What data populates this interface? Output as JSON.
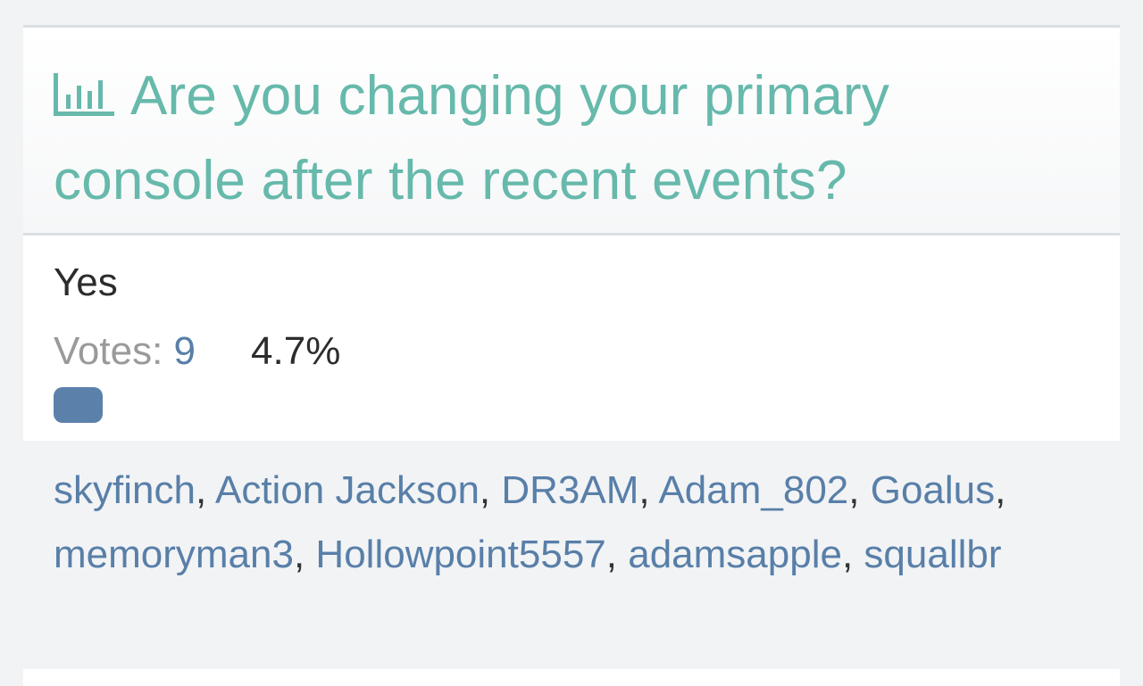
{
  "poll": {
    "title": "Are you changing your primary console after the recent events?",
    "icon": "bar-chart-icon",
    "accent_color": "#66b9ab"
  },
  "option": {
    "label": "Yes",
    "votes_label": "Votes: ",
    "votes_count": "9",
    "percent": "4.7%",
    "percent_value": 4.7,
    "bar_color": "#5b81ab"
  },
  "voters": [
    "skyfinch",
    "Action Jackson",
    "DR3AM",
    "Adam_802",
    "Goalus",
    "memoryman3",
    "Hollowpoint5557",
    "adamsapple",
    "squallbr"
  ]
}
